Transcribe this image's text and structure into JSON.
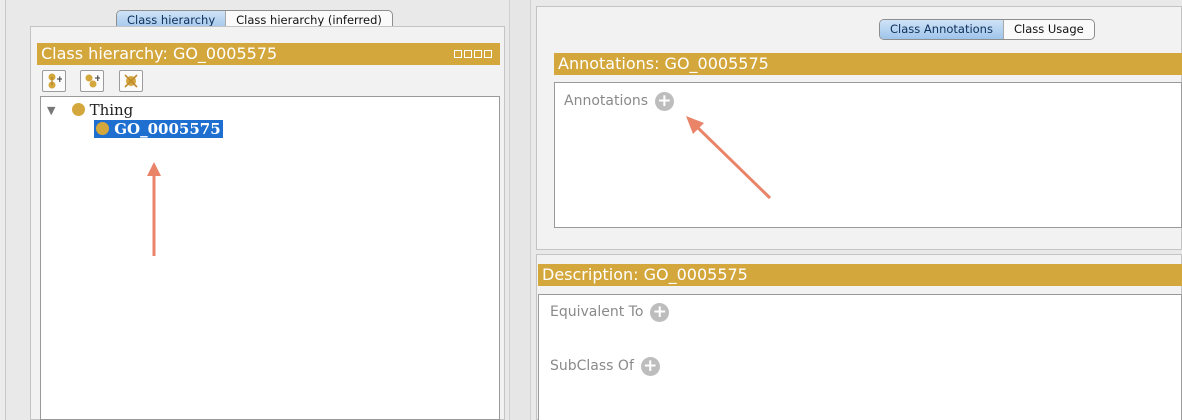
{
  "left_tabs": {
    "items": [
      "Class hierarchy",
      "Class hierarchy (inferred)"
    ],
    "active_index": 0
  },
  "hierarchy_panel": {
    "title": "Class hierarchy: GO_0005575",
    "toolbar_icons": [
      "add-subclass-icon",
      "add-sibling-icon",
      "delete-class-icon"
    ],
    "tree": {
      "root": "Thing",
      "children": [
        {
          "label": "GO_0005575",
          "selected": true
        }
      ]
    }
  },
  "right_tabs": {
    "items": [
      "Class Annotations",
      "Class Usage"
    ],
    "active_index": 0
  },
  "annotations_panel": {
    "title": "Annotations: GO_0005575",
    "section_label": "Annotations"
  },
  "description_panel": {
    "title": "Description: GO_0005575",
    "sections": [
      "Equivalent To",
      "SubClass Of"
    ]
  },
  "colors": {
    "header_gold": "#d4a73d",
    "selection_blue": "#1f6fd1",
    "arrow": "#e98468"
  }
}
